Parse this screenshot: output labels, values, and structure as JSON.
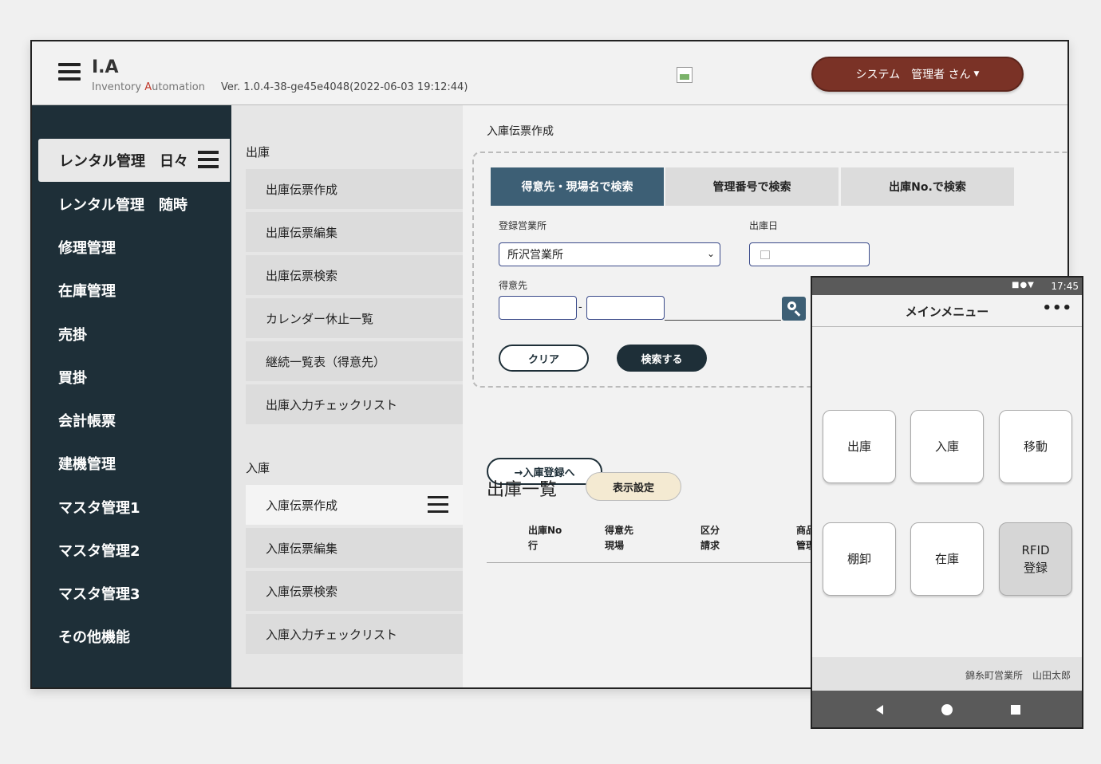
{
  "header": {
    "logo_title": "I.A",
    "logo_sub_pre": "Inventory ",
    "logo_sub_a": "A",
    "logo_sub_post": "utomation",
    "version": "Ver. 1.0.4-38-ge45e4048(2022-06-03 19:12:44)",
    "user_label": "システム　管理者 さん"
  },
  "sidebar": {
    "items": [
      {
        "label": "レンタル管理　日々"
      },
      {
        "label": "レンタル管理　随時"
      },
      {
        "label": "修理管理"
      },
      {
        "label": "在庫管理"
      },
      {
        "label": "売掛"
      },
      {
        "label": "買掛"
      },
      {
        "label": "会計帳票"
      },
      {
        "label": "建機管理"
      },
      {
        "label": "マスタ管理1"
      },
      {
        "label": "マスタ管理2"
      },
      {
        "label": "マスタ管理3"
      },
      {
        "label": "その他機能"
      }
    ]
  },
  "submenu": {
    "section_out": "出庫",
    "out_items": [
      "出庫伝票作成",
      "出庫伝票編集",
      "出庫伝票検索",
      "カレンダー休止一覧",
      "継続一覧表（得意先）",
      "出庫入力チェックリスト"
    ],
    "section_in": "入庫",
    "in_items": [
      "入庫伝票作成",
      "入庫伝票編集",
      "入庫伝票検索",
      "入庫入力チェックリスト"
    ]
  },
  "main": {
    "page_title": "入庫伝票作成",
    "tabs": [
      "得意先・現場名で検索",
      "管理番号で検索",
      "出庫No.で検索"
    ],
    "label_office": "登録営業所",
    "office_value": "所沢営業所",
    "label_date": "出庫日",
    "label_customer": "得意先",
    "dash": "-",
    "clear_label": "クリア",
    "search_label": "検索する",
    "register_label": "→入庫登録へ",
    "list_title": "出庫一覧",
    "display_settings": "表示設定",
    "columns": [
      {
        "l1": "出庫No",
        "l2": "行"
      },
      {
        "l1": "得意先",
        "l2": "現場"
      },
      {
        "l1": "区分",
        "l2": "請求"
      },
      {
        "l1": "商品",
        "l2": "管理"
      }
    ]
  },
  "phone": {
    "status_icons": "■●▼",
    "time": "17:45",
    "title": "メインメニュー",
    "more": "•••",
    "tiles": [
      "出庫",
      "入庫",
      "移動",
      "棚卸",
      "在庫",
      "RFID\n登録"
    ],
    "footer": "錦糸町営業所　山田太郎"
  },
  "colors": {
    "sidebar_bg": "#1e2f38",
    "user_button": "#7a3226",
    "active_tab": "#3d5f75"
  }
}
